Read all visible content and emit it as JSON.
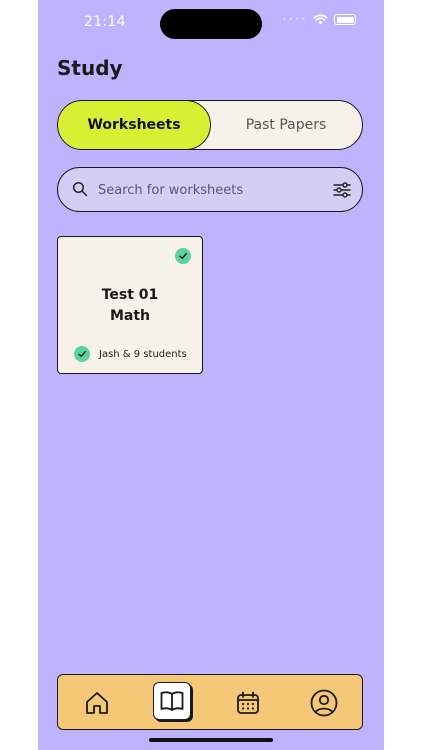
{
  "status_bar": {
    "time": "21:14"
  },
  "header": {
    "title": "Study"
  },
  "segmented": {
    "active_label": "Worksheets",
    "inactive_label": "Past Papers"
  },
  "search": {
    "placeholder": "Search for worksheets"
  },
  "worksheets": [
    {
      "title_line1": "Test 01",
      "title_line2": "Math",
      "participants": "Jash & 9 students"
    }
  ],
  "tabbar": {
    "items": [
      {
        "icon": "home-icon",
        "active": false
      },
      {
        "icon": "book-icon",
        "active": true
      },
      {
        "icon": "calendar-icon",
        "active": false
      },
      {
        "icon": "profile-icon",
        "active": false
      }
    ]
  },
  "colors": {
    "background": "#bfb3ff",
    "accent_green": "#d7f034",
    "check_green": "#5ad3a0",
    "tabbar": "#f5c878"
  }
}
